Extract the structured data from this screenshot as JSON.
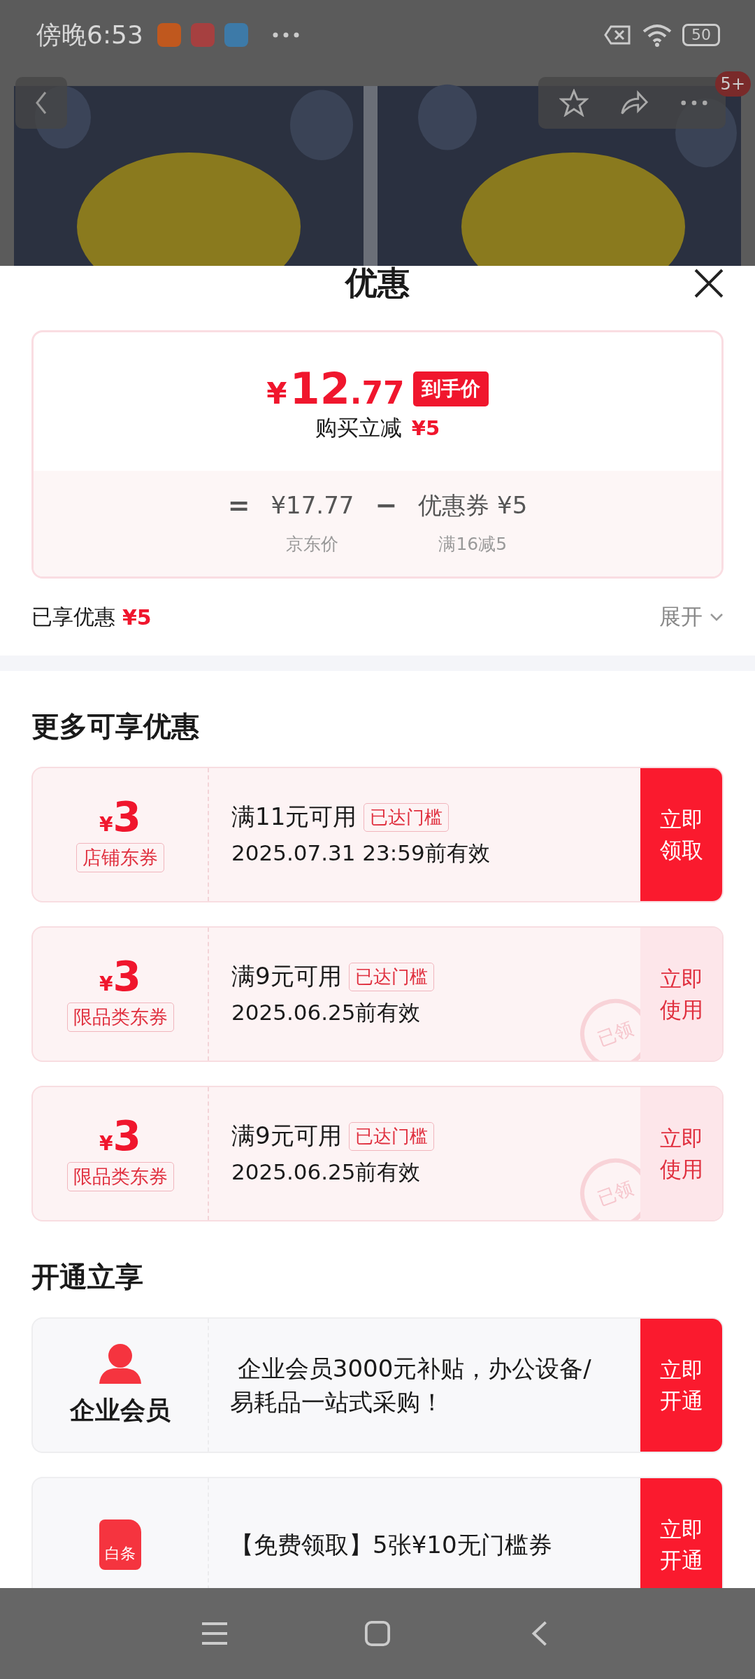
{
  "status_bar": {
    "time": "傍晚6:53",
    "battery": "50"
  },
  "header": {
    "badge": "5+"
  },
  "sheet": {
    "title": "优惠"
  },
  "price_card": {
    "price_symbol": "¥",
    "price_int": "12",
    "price_dec": ".77",
    "price_tag": "到手价",
    "instant_label": "购买立减",
    "instant_amount": "¥5",
    "equals": "=",
    "base_price": "¥17.77",
    "minus": "−",
    "coupon_label": "优惠券 ¥5",
    "base_caption": "京东价",
    "coupon_caption": "满16减5"
  },
  "enjoyed": {
    "label": "已享优惠",
    "amount": "¥5",
    "expand": "展开"
  },
  "more_title": "更多可享优惠",
  "coupons": [
    {
      "currency": "¥",
      "amount": "3",
      "type": "店铺东券",
      "condition": "满11元可用",
      "tag": "已达门槛",
      "validity": "2025.07.31 23:59前有效",
      "action": "立即领取",
      "claimed": false
    },
    {
      "currency": "¥",
      "amount": "3",
      "type": "限品类东券",
      "condition": "满9元可用",
      "tag": "已达门槛",
      "validity": "2025.06.25前有效",
      "action": "立即使用",
      "claimed": true,
      "stamp": "已领"
    },
    {
      "currency": "¥",
      "amount": "3",
      "type": "限品类东券",
      "condition": "满9元可用",
      "tag": "已达门槛",
      "validity": "2025.06.25前有效",
      "action": "立即使用",
      "claimed": true,
      "stamp": "已领"
    }
  ],
  "membership_title": "开通立享",
  "memberships": [
    {
      "kind": "person",
      "name": "企业会员",
      "description": " 企业会员3000元补贴，办公设备/易耗品一站式采购！",
      "action": "立即开通"
    },
    {
      "kind": "baitiao",
      "icon_text": "白条",
      "description": "【免费领取】5张¥10无门槛券",
      "action": "立即开通"
    }
  ]
}
